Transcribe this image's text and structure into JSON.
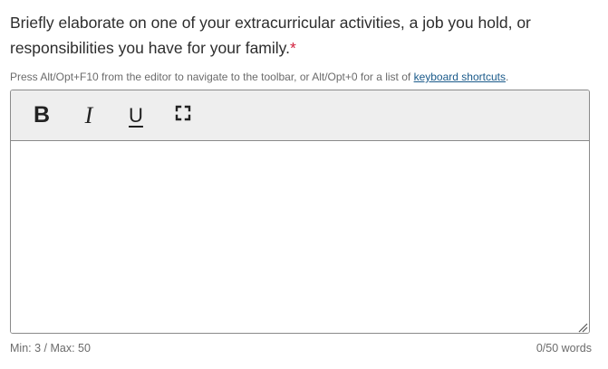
{
  "question": {
    "text": "Briefly elaborate on one of your extracurricular activities, a job you hold, or responsibilities you have for your family.",
    "required_marker": "*"
  },
  "hint": {
    "text": "Press Alt/Opt+F10 from the editor to navigate to the toolbar, or Alt/Opt+0 for a list of ",
    "link_label": "keyboard shortcuts",
    "suffix": "."
  },
  "toolbar": {
    "bold_label": "B",
    "italic_label": "I",
    "underline_label": "U",
    "fullscreen_icon": "fullscreen-icon"
  },
  "editor": {
    "value": ""
  },
  "footer": {
    "limits": "Min: 3 / Max: 50",
    "word_count": "0/50 words"
  },
  "colors": {
    "required": "#d21f3c",
    "link": "#1a5a8a",
    "toolbar_bg": "#eeeeee",
    "border": "#8a8a8a"
  }
}
